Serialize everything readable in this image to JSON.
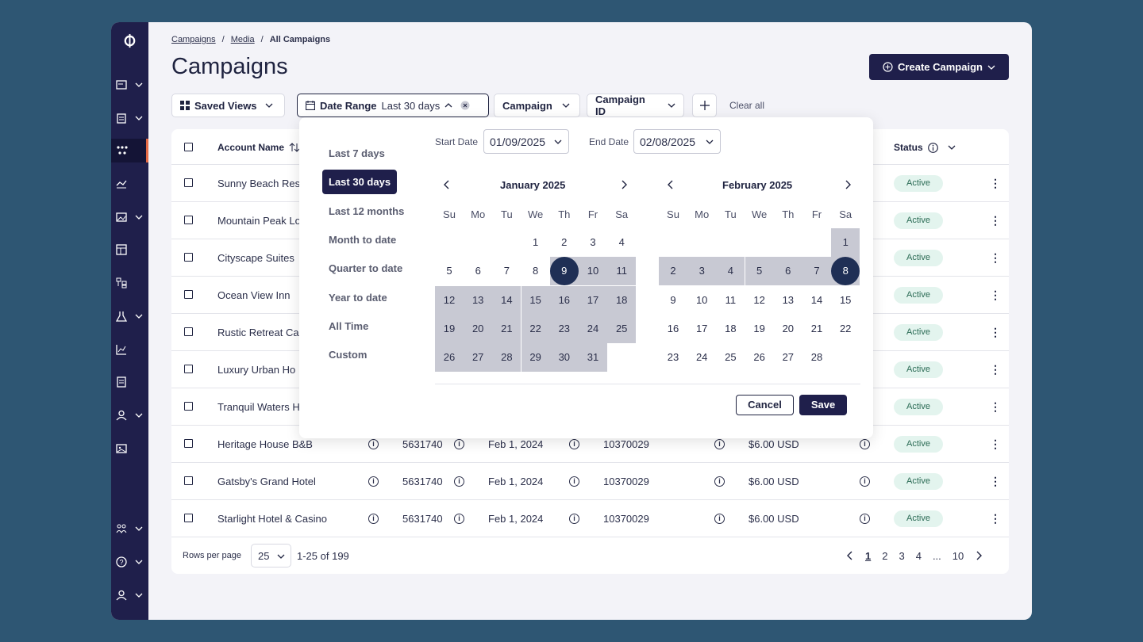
{
  "breadcrumb": {
    "items": [
      "Campaigns",
      "Media"
    ],
    "current": "All Campaigns"
  },
  "title": "Campaigns",
  "create_button": "Create Campaign",
  "filters": {
    "saved_views": "Saved Views",
    "date_range_label": "Date Range",
    "date_range_value": "Last 30 days",
    "campaign": "Campaign",
    "campaign_id": "Campaign ID",
    "clear_all": "Clear all"
  },
  "table": {
    "headers": {
      "account_name": "Account Name",
      "status": "Status"
    },
    "rows": [
      {
        "name": "Sunny Beach Res",
        "status": "Active"
      },
      {
        "name": "Mountain Peak Lo",
        "status": "Active"
      },
      {
        "name": "Cityscape Suites",
        "status": "Active"
      },
      {
        "name": "Ocean View Inn",
        "status": "Active"
      },
      {
        "name": "Rustic Retreat Ca",
        "status": "Active"
      },
      {
        "name": "Luxury Urban Ho",
        "status": "Active"
      },
      {
        "name": "Tranquil Waters H",
        "status": "Active"
      },
      {
        "name": "Heritage House B&B",
        "id": "5631740",
        "date": "Feb 1, 2024",
        "code": "10370029",
        "amount": "$6.00 USD",
        "status": "Active"
      },
      {
        "name": "Gatsby's Grand Hotel",
        "id": "5631740",
        "date": "Feb 1, 2024",
        "code": "10370029",
        "amount": "$6.00 USD",
        "status": "Active"
      },
      {
        "name": "Starlight Hotel & Casino",
        "id": "5631740",
        "date": "Feb 1, 2024",
        "code": "10370029",
        "amount": "$6.00 USD",
        "status": "Active"
      }
    ]
  },
  "pagination": {
    "rows_per_page_label": "Rows per page",
    "rows_per_page": "25",
    "range": "1-25 of 199",
    "pages": [
      "1",
      "2",
      "3",
      "4",
      "...",
      "10"
    ]
  },
  "date_picker": {
    "presets": [
      "Last 7 days",
      "Last 30 days",
      "Last 12 months",
      "Month to date",
      "Quarter to date",
      "Year to date",
      "All Time",
      "Custom"
    ],
    "selected_preset": "Last 30 days",
    "start_label": "Start Date",
    "start_value": "01/09/2025",
    "end_label": "End Date",
    "end_value": "02/08/2025",
    "weekdays": [
      "Su",
      "Mo",
      "Tu",
      "We",
      "Th",
      "Fr",
      "Sa"
    ],
    "months": [
      {
        "title": "January 2025",
        "first_weekday": 3,
        "days": 31,
        "range_start": 9,
        "range_end": 31,
        "cap": 9
      },
      {
        "title": "February 2025",
        "first_weekday": 6,
        "days": 28,
        "range_start": 1,
        "range_end": 8,
        "cap": 8
      }
    ],
    "cancel": "Cancel",
    "save": "Save"
  }
}
